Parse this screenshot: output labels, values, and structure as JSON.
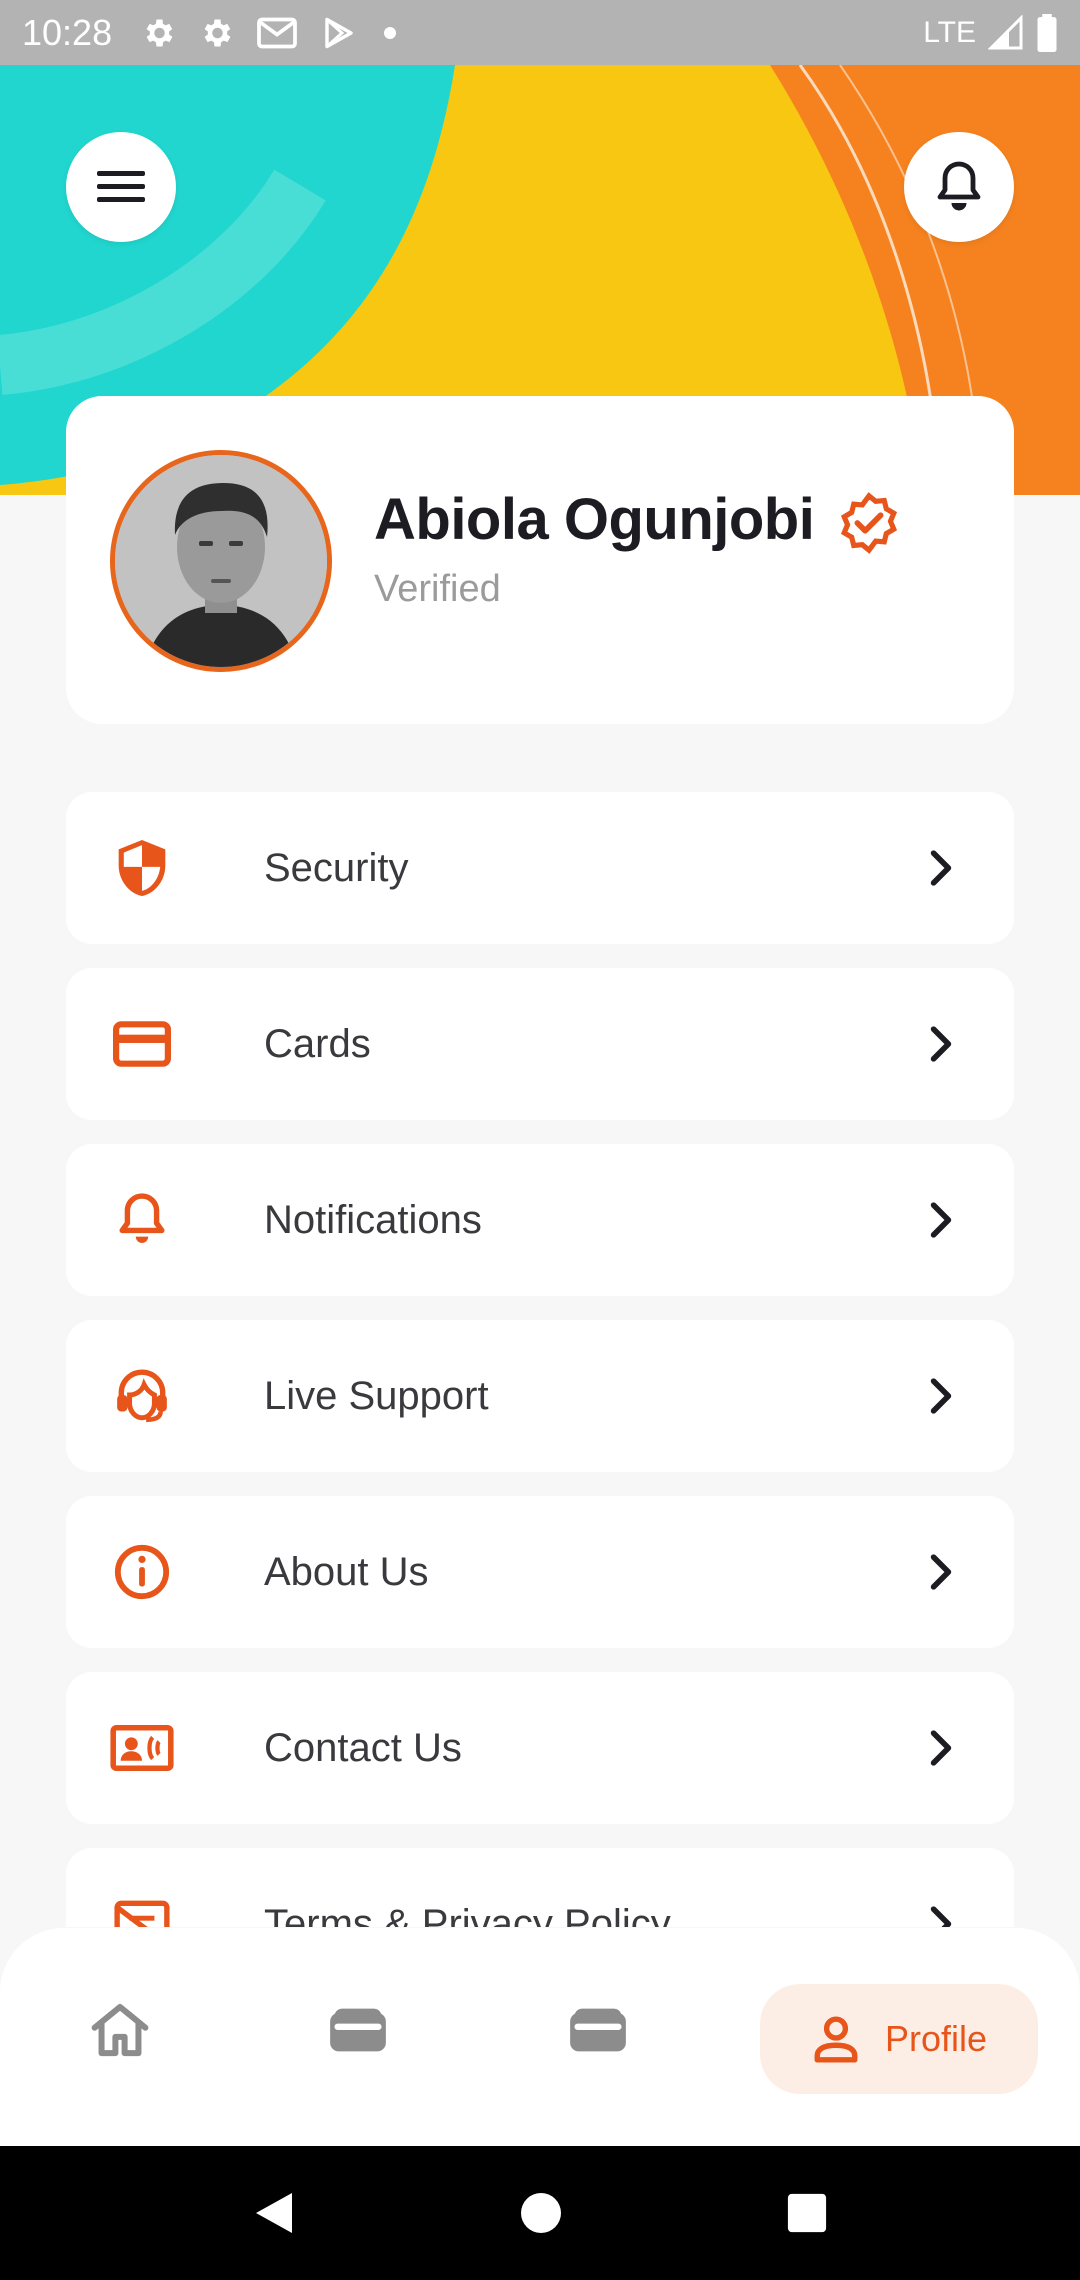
{
  "status_bar": {
    "time": "10:28",
    "network": "LTE",
    "icons": [
      "settings-icon",
      "settings-icon",
      "gmail-icon",
      "play-store-icon",
      "dot-icon"
    ]
  },
  "header": {
    "menu_icon": "hamburger-icon",
    "bell_icon": "bell-icon",
    "colors": {
      "teal": "#21d6cf",
      "yellow": "#f8c712",
      "orange": "#f5821f"
    }
  },
  "profile": {
    "name": "Abiola Ogunjobi",
    "status": "Verified",
    "badge_icon": "verified-badge-icon"
  },
  "menu": {
    "items": [
      {
        "label": "Security",
        "icon": "shield-icon"
      },
      {
        "label": "Cards",
        "icon": "card-icon"
      },
      {
        "label": "Notifications",
        "icon": "bell-icon"
      },
      {
        "label": "Live Support",
        "icon": "headset-icon"
      },
      {
        "label": "About Us",
        "icon": "info-icon"
      },
      {
        "label": "Contact Us",
        "icon": "contact-card-icon"
      },
      {
        "label": "Terms & Privacy Policy",
        "icon": "document-icon"
      }
    ]
  },
  "bottom_nav": {
    "items": [
      {
        "icon": "home-icon"
      },
      {
        "icon": "wallet-icon"
      },
      {
        "icon": "wallet-icon"
      },
      {
        "icon": "profile-icon",
        "label": "Profile",
        "active": true
      }
    ]
  },
  "theme": {
    "accent": "#e8551a",
    "active_bg": "#fdeee5"
  }
}
